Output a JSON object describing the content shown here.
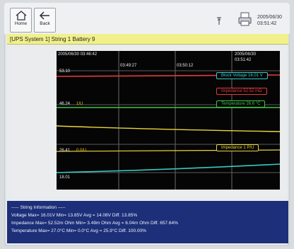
{
  "toolbar": {
    "home_label": "Home",
    "back_label": "Back",
    "date": "2005/06/30",
    "time": "03:51:42"
  },
  "breadcrumb": "[UPS System 1] String 1 Battery 9",
  "trend": {
    "start_timestamp": "2005/06/30 03:46:42",
    "end_date": "2005/06/30",
    "end_time": "03:51:42",
    "time_ticks": [
      "03:49:27",
      "03:50:12"
    ],
    "left_values": [
      {
        "text": "53.10",
        "color": "#e8e8e8"
      },
      {
        "text": "46.24",
        "color": "#e8e8e8"
      },
      {
        "text": "1/U",
        "color": "#f0c020"
      },
      {
        "text": "26.41",
        "color": "#e8e8e8"
      },
      {
        "text": "0.0/U",
        "color": "#f0c020"
      },
      {
        "text": "18.01",
        "color": "#e8e8e8"
      }
    ],
    "series_labels": [
      {
        "text": "Block Voltage 16.01 V",
        "color": "#37c9c6"
      },
      {
        "text": "Impedance 52.52 mΩ",
        "color": "#e63a3a"
      },
      {
        "text": "Temperature 26.6 °C",
        "color": "#3ec44a"
      },
      {
        "text": "Impedance 1 P/U",
        "color": "#e8d63a"
      }
    ]
  },
  "info": {
    "heading": "----- String Information -----",
    "lines": [
      "Voltage Max= 16.01V  Min= 13.85V  Avg = 14.08V  Diff. 13.85%",
      "Impedance Max= 52.52m Ohm  Min= 3.49m Ohm  Avg = 6.04m Ohm  Diff. 657.64%",
      "Temperature Max= 27.0°C  Min= 0.0°C  Avg = 25.9°C  Diff. 100.00%"
    ]
  },
  "colors": {
    "voltage": "#37c9c6",
    "impedance": "#e63a3a",
    "temperature": "#3ec44a",
    "impedance_pu": "#e8d63a",
    "info_bg": "#1c2f78",
    "breadcrumb_bg": "#f2f08a"
  },
  "icons": [
    "home-icon",
    "back-arrow-icon",
    "pin-icon",
    "printer-icon"
  ]
}
